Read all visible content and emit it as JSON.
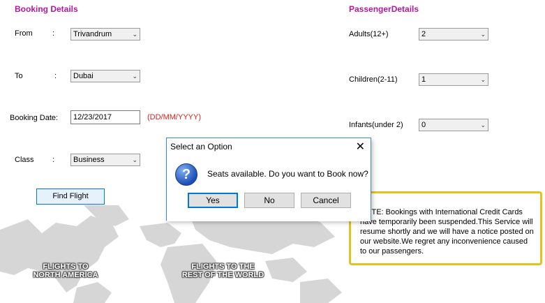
{
  "booking": {
    "title": "Booking Details",
    "from_label": "From",
    "from_value": "Trivandrum",
    "to_label": "To",
    "to_value": "Dubai",
    "colon": ":",
    "date_label": "Booking Date:",
    "date_value": "12/23/2017",
    "date_hint": "(DD/MM/YYYY)",
    "class_label": "Class",
    "class_value": "Business",
    "find_button": "Find Flight"
  },
  "passenger": {
    "title": "PassengerDetails",
    "adults_label": "Adults(12+)",
    "adults_value": "2",
    "children_label": "Children(2-11)",
    "children_value": "1",
    "infants_label": "Infants(under 2)",
    "infants_value": "0"
  },
  "map": {
    "label_left_line1": "FLIGHTS TO",
    "label_left_line2": "NORTH AMERICA",
    "label_right_line1": "FLIGHTS TO THE",
    "label_right_line2": "REST OF THE WORLD"
  },
  "notice": {
    "text": "NOTE: Bookings with International Credit Cards have temporarily been suspended.This Service will resume shortly and we will have a notice posted on our website.We regret any inconvenience caused to our passengers."
  },
  "dialog": {
    "title": "Select an Option",
    "message": "Seats available. Do you want to Book now?",
    "yes": "Yes",
    "no": "No",
    "cancel": "Cancel",
    "question_glyph": "?",
    "close_glyph": "✕"
  },
  "colors": {
    "title": "#b5179e",
    "hint": "#e0201b",
    "notice_border": "#e4c21f",
    "dialog_border": "#3c8ad6"
  }
}
